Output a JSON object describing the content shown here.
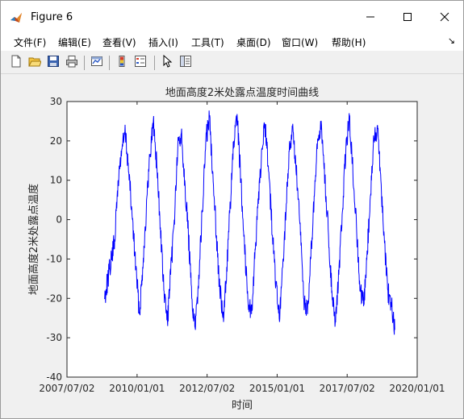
{
  "window": {
    "title": "Figure 6",
    "icons": {
      "app": "matlab-figure-icon",
      "minimize": "minimize-icon",
      "maximize": "maximize-icon",
      "close": "close-icon"
    }
  },
  "menu": {
    "items": [
      "文件(F)",
      "编辑(E)",
      "查看(V)",
      "插入(I)",
      "工具(T)",
      "桌面(D)",
      "窗口(W)",
      "帮助(H)"
    ],
    "overflow_arrow": "↘"
  },
  "toolbar": {
    "buttons": [
      "new-figure-icon",
      "open-file-icon",
      "save-icon",
      "print-icon",
      "link-plot-icon",
      "insert-colorbar-icon",
      "insert-legend-icon",
      "pointer-icon",
      "property-inspector-icon"
    ]
  },
  "colors": {
    "plot_line": "#0000ff",
    "axes_bg": "#ffffff",
    "figure_bg": "#f0f0f0"
  },
  "chart_data": {
    "type": "line",
    "title": "地面高度2米处露点温度时间曲线",
    "xlabel": "时间",
    "ylabel": "地面高度2米处露点温度",
    "xlim": [
      "2007/07/02",
      "2020/01/01"
    ],
    "ylim": [
      -40,
      30
    ],
    "xticks": [
      "2007/07/02",
      "2010/01/01",
      "2012/07/02",
      "2015/01/01",
      "2017/07/02",
      "2020/01/01"
    ],
    "yticks": [
      -40,
      -30,
      -20,
      -10,
      0,
      10,
      20,
      30
    ],
    "grid": false,
    "series": [
      {
        "color": "#0000ff",
        "x": [
          "2008/11/01",
          "2008/12/15",
          "2009/02/01",
          "2009/03/15",
          "2009/05/01",
          "2009/06/15",
          "2009/08/01",
          "2009/09/15",
          "2009/11/01",
          "2009/12/15",
          "2010/02/01",
          "2010/03/15",
          "2010/05/01",
          "2010/06/15",
          "2010/08/01",
          "2010/09/15",
          "2010/11/01",
          "2010/12/15",
          "2011/02/01",
          "2011/03/15",
          "2011/05/01",
          "2011/06/15",
          "2011/08/01",
          "2011/09/15",
          "2011/11/01",
          "2011/12/15",
          "2012/02/01",
          "2012/03/15",
          "2012/05/01",
          "2012/06/15",
          "2012/08/01",
          "2012/09/15",
          "2012/11/01",
          "2012/12/15",
          "2013/02/01",
          "2013/03/15",
          "2013/05/01",
          "2013/06/15",
          "2013/08/01",
          "2013/09/15",
          "2013/11/01",
          "2013/12/15",
          "2014/02/01",
          "2014/03/15",
          "2014/05/01",
          "2014/06/15",
          "2014/08/01",
          "2014/09/15",
          "2014/11/01",
          "2014/12/15",
          "2015/02/01",
          "2015/03/15",
          "2015/05/01",
          "2015/06/15",
          "2015/08/01",
          "2015/09/15",
          "2015/11/01",
          "2015/12/15",
          "2016/02/01",
          "2016/03/15",
          "2016/05/01",
          "2016/06/15",
          "2016/08/01",
          "2016/09/15",
          "2016/11/01",
          "2016/12/15",
          "2017/02/01",
          "2017/03/15",
          "2017/05/01",
          "2017/06/15",
          "2017/08/01",
          "2017/09/15",
          "2017/11/01",
          "2017/12/15",
          "2018/02/01",
          "2018/03/15",
          "2018/05/01",
          "2018/06/15",
          "2018/08/01",
          "2018/09/15",
          "2018/11/01",
          "2018/12/15",
          "2019/02/01",
          "2019/03/15"
        ],
        "y": [
          -20,
          -15,
          -10,
          -5,
          10,
          18,
          22,
          12,
          0,
          -12,
          -24,
          -12,
          2,
          16,
          25,
          14,
          -2,
          -18,
          -26,
          -14,
          0,
          18,
          22,
          10,
          -4,
          -20,
          -28,
          -14,
          2,
          20,
          26,
          12,
          -4,
          -18,
          -26,
          -12,
          4,
          20,
          25,
          10,
          -6,
          -20,
          -24,
          -10,
          4,
          18,
          24,
          12,
          -4,
          -16,
          -26,
          -12,
          4,
          20,
          22,
          10,
          -4,
          -20,
          -24,
          -10,
          6,
          20,
          24,
          10,
          -4,
          -18,
          -26,
          -14,
          2,
          18,
          26,
          12,
          -2,
          -18,
          -22,
          -10,
          6,
          20,
          24,
          10,
          -6,
          -18,
          -22,
          -28
        ]
      }
    ]
  }
}
